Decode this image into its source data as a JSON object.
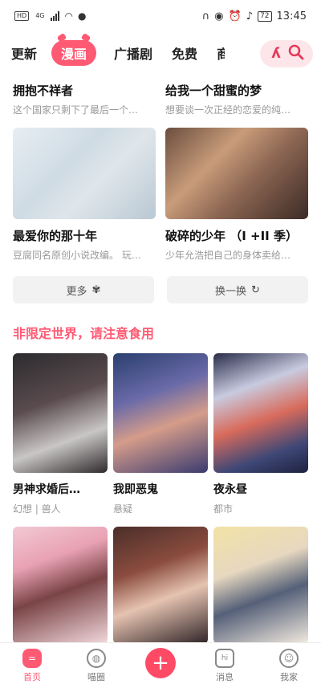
{
  "status": {
    "hd": "HD",
    "net": "4G",
    "time": "13:45",
    "battery": "72"
  },
  "tabs": [
    "更新",
    "漫画",
    "广播剧",
    "免费",
    "商"
  ],
  "featured": [
    {
      "title": "拥抱不祥者",
      "desc": "这个国家只剩下了最后一个…"
    },
    {
      "title": "给我一个甜蜜的梦",
      "desc": "想要谈一次正经的恋爱的纯…"
    },
    {
      "title": "最爱你的那十年",
      "desc": "豆腐同名原创小说改编。 玩…"
    },
    {
      "title": "破碎的少年 （I +II 季）",
      "desc": "少年允浩把自己的身体卖给…"
    }
  ],
  "actions": {
    "more": "更多",
    "refresh": "换一换"
  },
  "section": {
    "title": "非限定世界，请注意食用"
  },
  "comics": [
    {
      "title": "男神求婚后…",
      "tags": "幻想 | 兽人"
    },
    {
      "title": "我即恶鬼",
      "tags": "悬疑"
    },
    {
      "title": "夜永昼",
      "tags": "都市"
    }
  ],
  "nav": [
    "首页",
    "喵圈",
    "",
    "消息",
    "我家"
  ],
  "colors": {
    "accent": "#ff5a74"
  }
}
